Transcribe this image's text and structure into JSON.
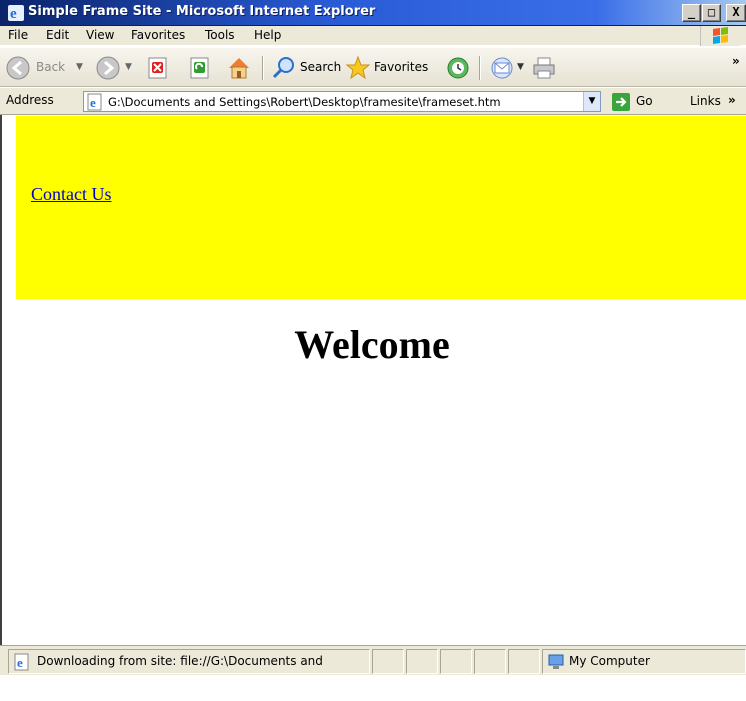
{
  "window": {
    "title": "Simple Frame Site - Microsoft Internet Explorer",
    "minimize_glyph": "_",
    "maximize_glyph": "□",
    "close_glyph": "X"
  },
  "menu": {
    "items": [
      "File",
      "Edit",
      "View",
      "Favorites",
      "Tools",
      "Help"
    ]
  },
  "toolbar": {
    "back_label": "Back",
    "search_label": "Search",
    "favorites_label": "Favorites",
    "overflow": "»"
  },
  "address": {
    "label": "Address",
    "value": "G:\\Documents and Settings\\Robert\\Desktop\\framesite\\frameset.htm",
    "go_label": "Go",
    "links_label": "Links",
    "links_overflow": "»"
  },
  "top_frame": {
    "background": "#ffff00",
    "link_text": "Contact Us"
  },
  "main_frame": {
    "heading": "Welcome"
  },
  "status": {
    "text": "Downloading from site: file://G:\\Documents and",
    "zone": "My Computer"
  },
  "colors": {
    "title_gradient_start": "#0a246a",
    "link": "#0000cc",
    "frame_yellow": "#ffff00"
  }
}
